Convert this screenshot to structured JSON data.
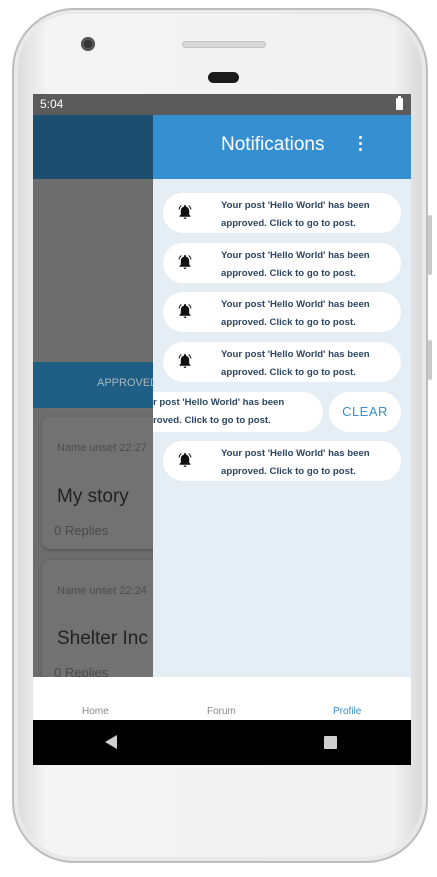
{
  "status_bar": {
    "time": "5:04"
  },
  "background_screen": {
    "tab_label": "APPROVED",
    "posts": [
      {
        "meta": "Name unset 22:27",
        "title": "My story",
        "replies": "0 Replies"
      },
      {
        "meta": "Name unset 22:24",
        "title": "Shelter Inc",
        "replies": "0 Replies"
      }
    ]
  },
  "drawer": {
    "title": "Notifications",
    "notifications": [
      {
        "line1": "Your post 'Hello World' has been",
        "line2": "approved. Click to go to post."
      },
      {
        "line1": "Your post 'Hello World' has been",
        "line2": "approved. Click to go to post."
      },
      {
        "line1": "Your post 'Hello World' has been",
        "line2": "approved. Click to go to post."
      },
      {
        "line1": "Your post 'Hello World' has been",
        "line2": "approved. Click to go to post."
      },
      {
        "line1": "r post 'Hello World' has been",
        "line2": "roved. Click to go to post."
      },
      {
        "line1": "Your post 'Hello World' has been",
        "line2": "approved. Click to go to post."
      }
    ],
    "clear_label": "CLEAR"
  },
  "bottom_nav": {
    "items": [
      {
        "label": "Home"
      },
      {
        "label": "Forum"
      },
      {
        "label": "Profile"
      }
    ],
    "active": "Profile"
  },
  "colors": {
    "drawer_header": "#368fd1",
    "drawer_bg": "#e5eef5",
    "accent": "#3b8fd0",
    "dim_appbar": "#1c4f6f"
  },
  "icons": {
    "notification": "bell-icon",
    "menu": "more-vert-icon",
    "system_back": "back-triangle-icon",
    "system_recents": "recents-square-icon"
  }
}
